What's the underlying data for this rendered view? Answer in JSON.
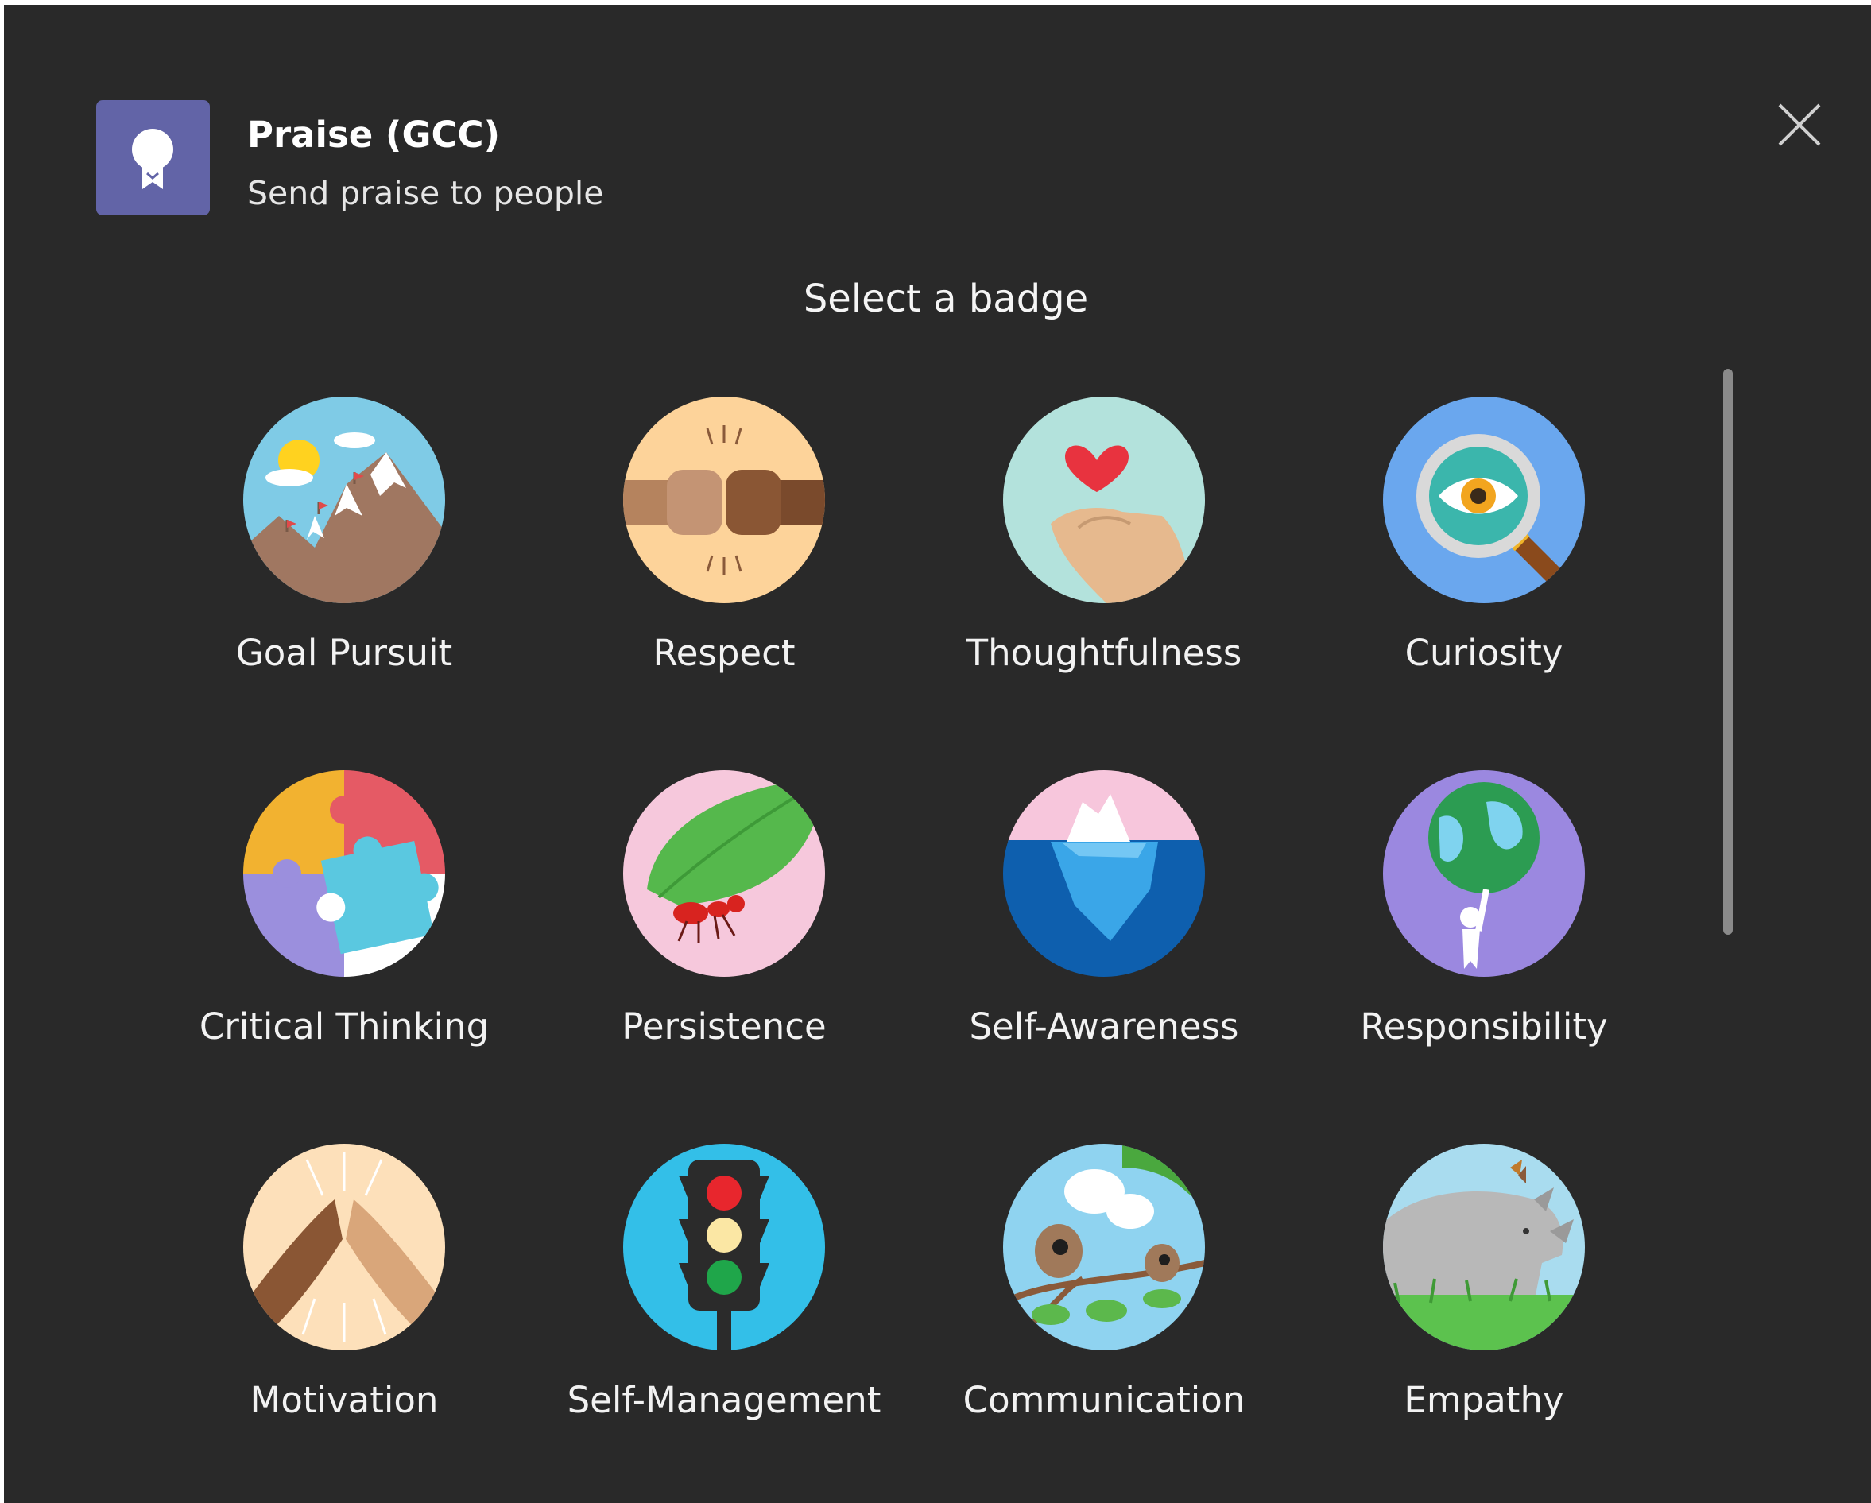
{
  "header": {
    "app_title": "Praise (GCC)",
    "app_subtitle": "Send praise to people",
    "app_icon": "ribbon-badge-icon",
    "close_icon": "close-icon"
  },
  "main": {
    "title": "Select a badge",
    "badges": [
      {
        "label": "Goal Pursuit",
        "icon": "mountains-icon"
      },
      {
        "label": "Respect",
        "icon": "fist-bump-icon"
      },
      {
        "label": "Thoughtfulness",
        "icon": "heart-hand-icon"
      },
      {
        "label": "Curiosity",
        "icon": "magnifier-eye-icon"
      },
      {
        "label": "Critical Thinking",
        "icon": "puzzle-icon"
      },
      {
        "label": "Persistence",
        "icon": "ant-leaf-icon"
      },
      {
        "label": "Self-Awareness",
        "icon": "iceberg-icon"
      },
      {
        "label": "Responsibility",
        "icon": "globe-person-icon"
      },
      {
        "label": "Motivation",
        "icon": "high-five-icon"
      },
      {
        "label": "Self-Management",
        "icon": "traffic-light-icon"
      },
      {
        "label": "Communication",
        "icon": "birds-chat-icon"
      },
      {
        "label": "Empathy",
        "icon": "rhino-icon"
      }
    ]
  },
  "colors": {
    "background": "#292929",
    "brand": "#6264a7",
    "text": "#ffffff"
  }
}
